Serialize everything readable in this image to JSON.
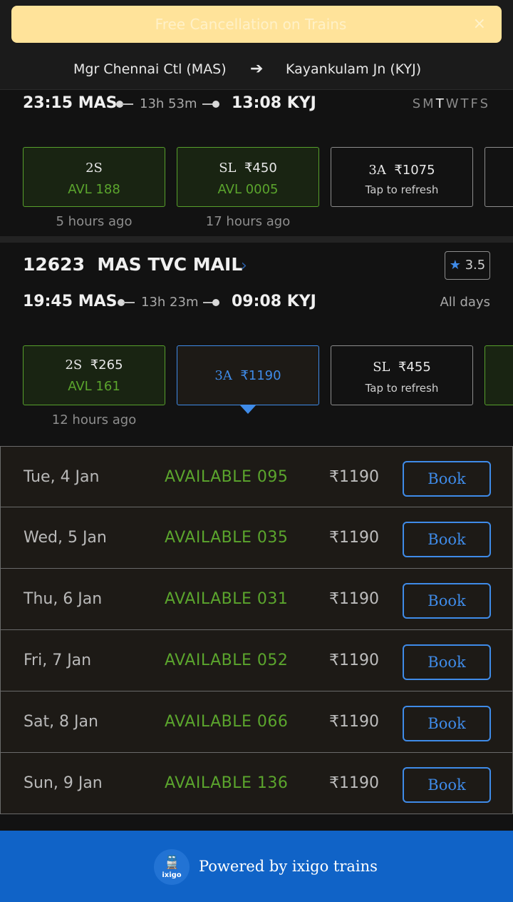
{
  "banner": {
    "text": "Free Cancellation on Trains",
    "close": "×"
  },
  "route": {
    "from": "Mgr Chennai Ctl (MAS)",
    "arrow": "➔",
    "to": "Kayankulam Jn (KYJ)"
  },
  "train1": {
    "departure": "23:15 MAS",
    "duration": "13h 53m",
    "arrival": "13:08 KYJ",
    "days": [
      "S",
      "M",
      "T",
      "W",
      "T",
      "F",
      "S"
    ],
    "classes": [
      {
        "name": "2S",
        "price": "",
        "status": "AVL 188",
        "updated": "5 hours ago"
      },
      {
        "name": "SL",
        "price": "₹450",
        "status": "AVL 0005",
        "updated": "17 hours ago"
      },
      {
        "name": "3A",
        "price": "₹1075",
        "status": "Tap to refresh",
        "updated": ""
      }
    ]
  },
  "train2": {
    "number": "12623",
    "name": "MAS TVC MAIL",
    "chevron": "›",
    "rating": "3.5",
    "departure": "19:45 MAS",
    "duration": "13h 23m",
    "arrival": "09:08 KYJ",
    "runs": "All days",
    "classes": [
      {
        "name": "2S",
        "price": "₹265",
        "status": "AVL 161",
        "updated": "12 hours ago"
      },
      {
        "name": "3A",
        "price": "₹1190",
        "status": "",
        "updated": ""
      },
      {
        "name": "SL",
        "price": "₹455",
        "status": "Tap to refresh",
        "updated": ""
      }
    ]
  },
  "availability": [
    {
      "date": "Tue, 4 Jan",
      "status": "AVAILABLE 095",
      "price": "₹1190",
      "action": "Book"
    },
    {
      "date": "Wed, 5 Jan",
      "status": "AVAILABLE 035",
      "price": "₹1190",
      "action": "Book"
    },
    {
      "date": "Thu, 6 Jan",
      "status": "AVAILABLE 031",
      "price": "₹1190",
      "action": "Book"
    },
    {
      "date": "Fri, 7 Jan",
      "status": "AVAILABLE 052",
      "price": "₹1190",
      "action": "Book"
    },
    {
      "date": "Sat, 8 Jan",
      "status": "AVAILABLE 066",
      "price": "₹1190",
      "action": "Book"
    },
    {
      "date": "Sun, 9 Jan",
      "status": "AVAILABLE 136",
      "price": "₹1190",
      "action": "Book"
    }
  ],
  "footer": {
    "logo_text": "ixigo",
    "text": "Powered by ixigo trains"
  },
  "colors": {
    "available": "#5ba52d",
    "accent": "#3f8be8",
    "footer": "#1063c7",
    "banner": "#ffe39a"
  },
  "icons": {
    "close": "close-icon",
    "arrow": "arrow-right-icon",
    "star": "star-icon",
    "chevron": "chevron-right-icon",
    "train": "train-icon"
  }
}
